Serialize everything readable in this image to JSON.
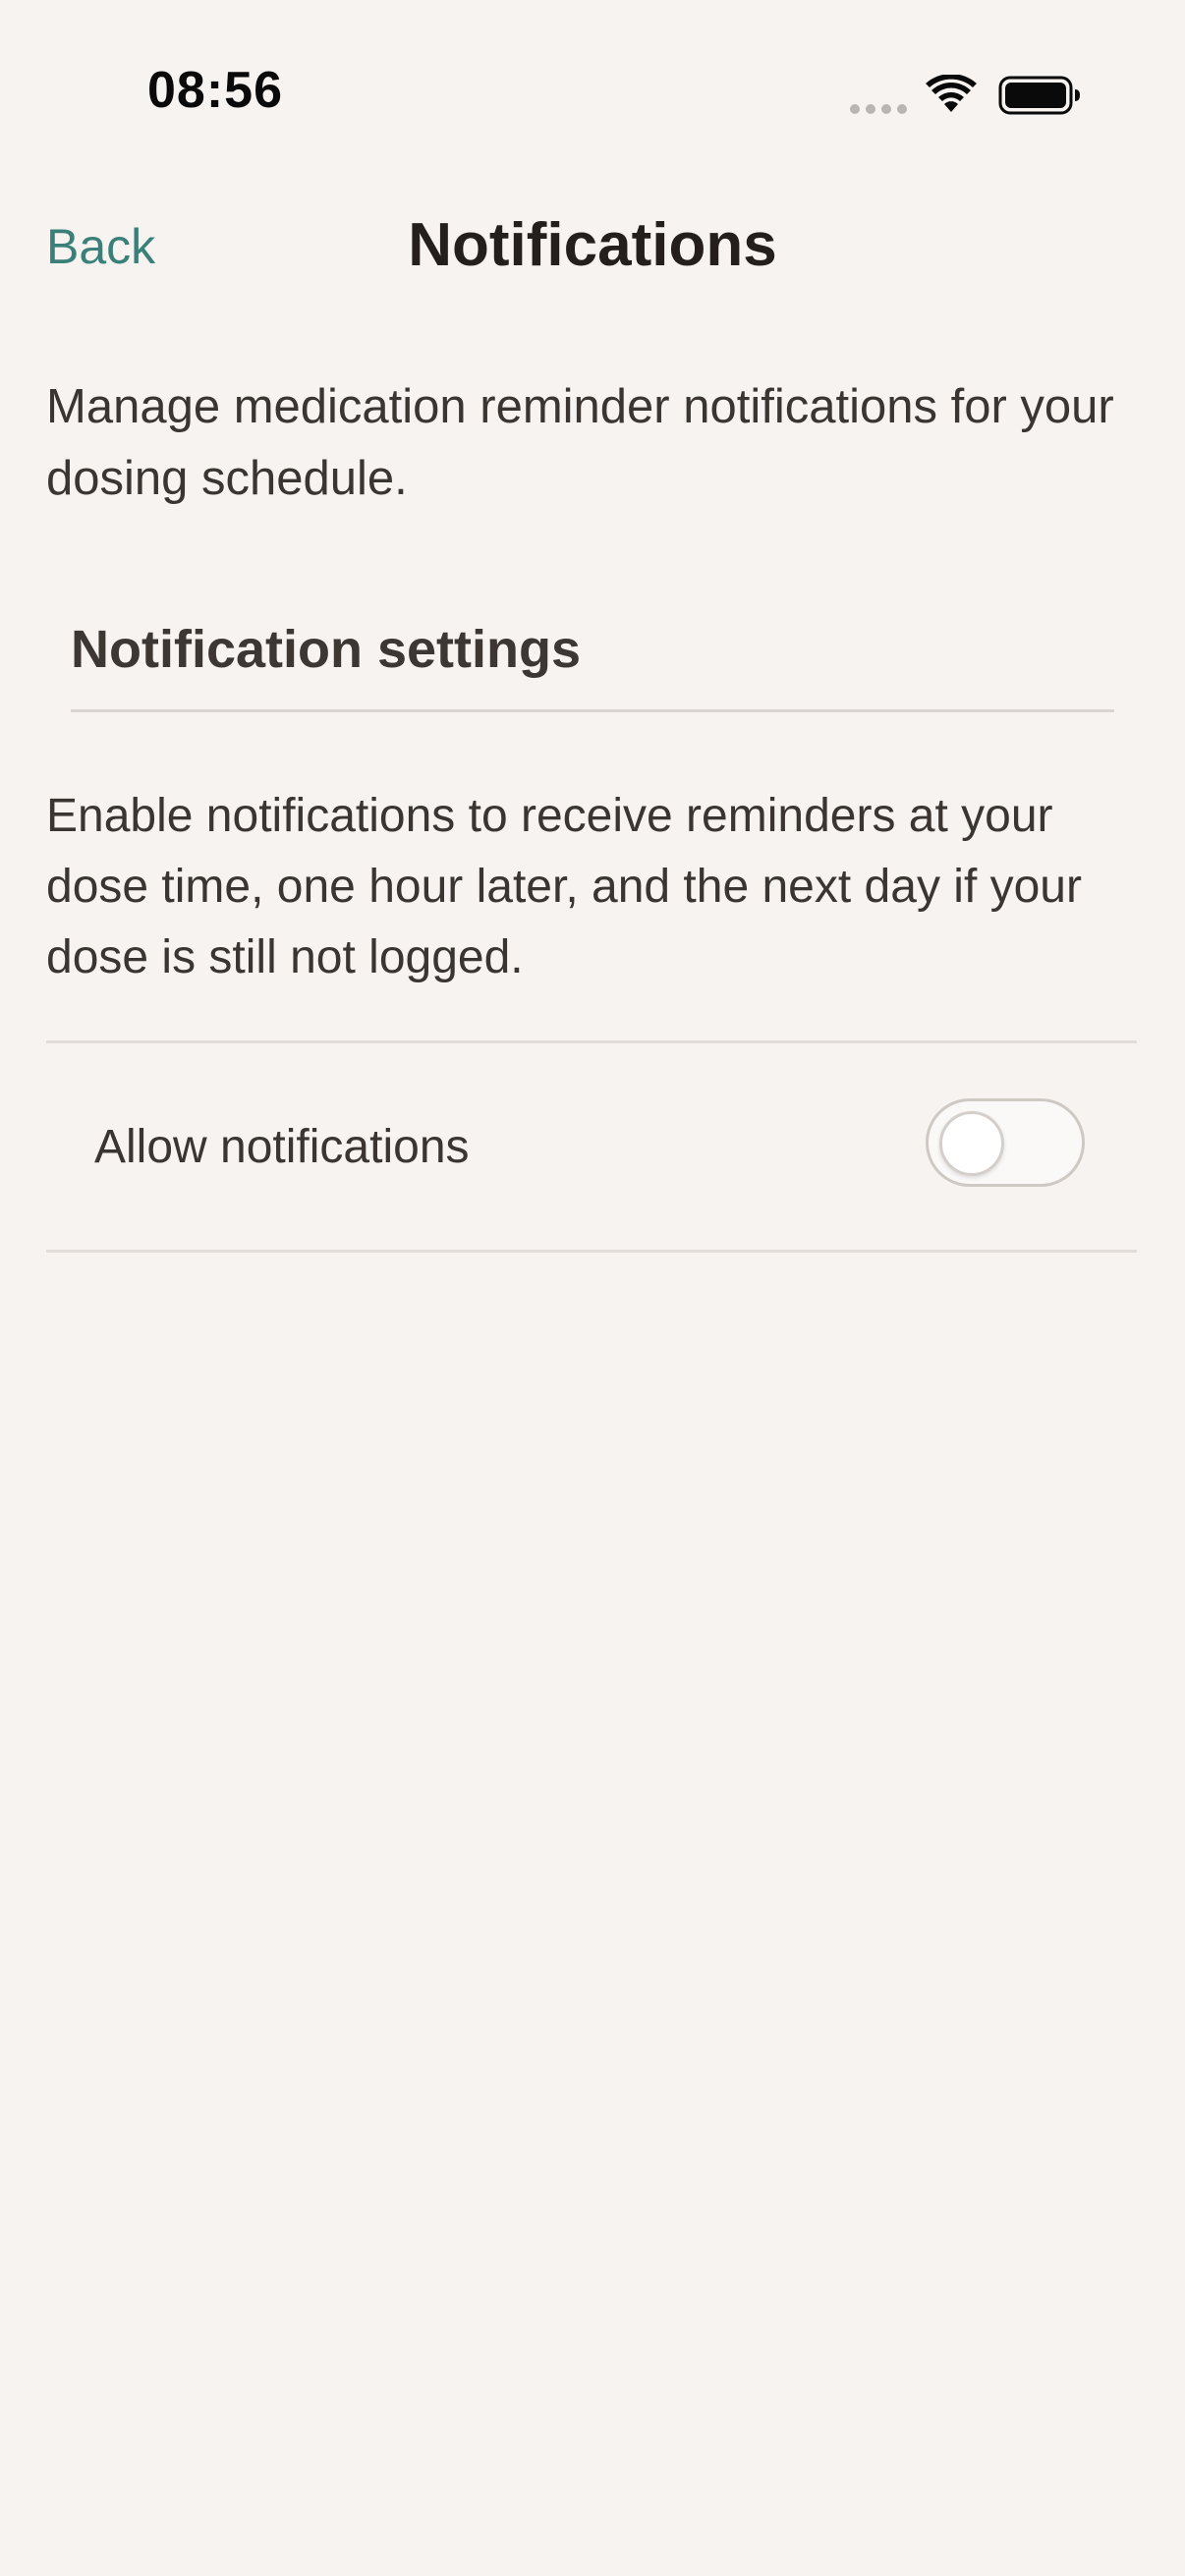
{
  "status_bar": {
    "time": "08:56",
    "icons": [
      "cellular-signal-icon",
      "wifi-icon",
      "battery-icon"
    ]
  },
  "nav": {
    "back_label": "Back",
    "title": "Notifications"
  },
  "intro": {
    "text": "Manage medication reminder notifications for your dosing schedule."
  },
  "section": {
    "title": "Notification settings",
    "description": "Enable notifications to receive reminders at your dose time, one hour later, and the next day if your dose is still not logged."
  },
  "settings": {
    "allow_notifications": {
      "label": "Allow notifications",
      "enabled": false
    }
  },
  "colors": {
    "background": "#f7f3f0",
    "accent": "#3a8079",
    "text": "#2b2724",
    "divider": "#e2ddd9"
  }
}
